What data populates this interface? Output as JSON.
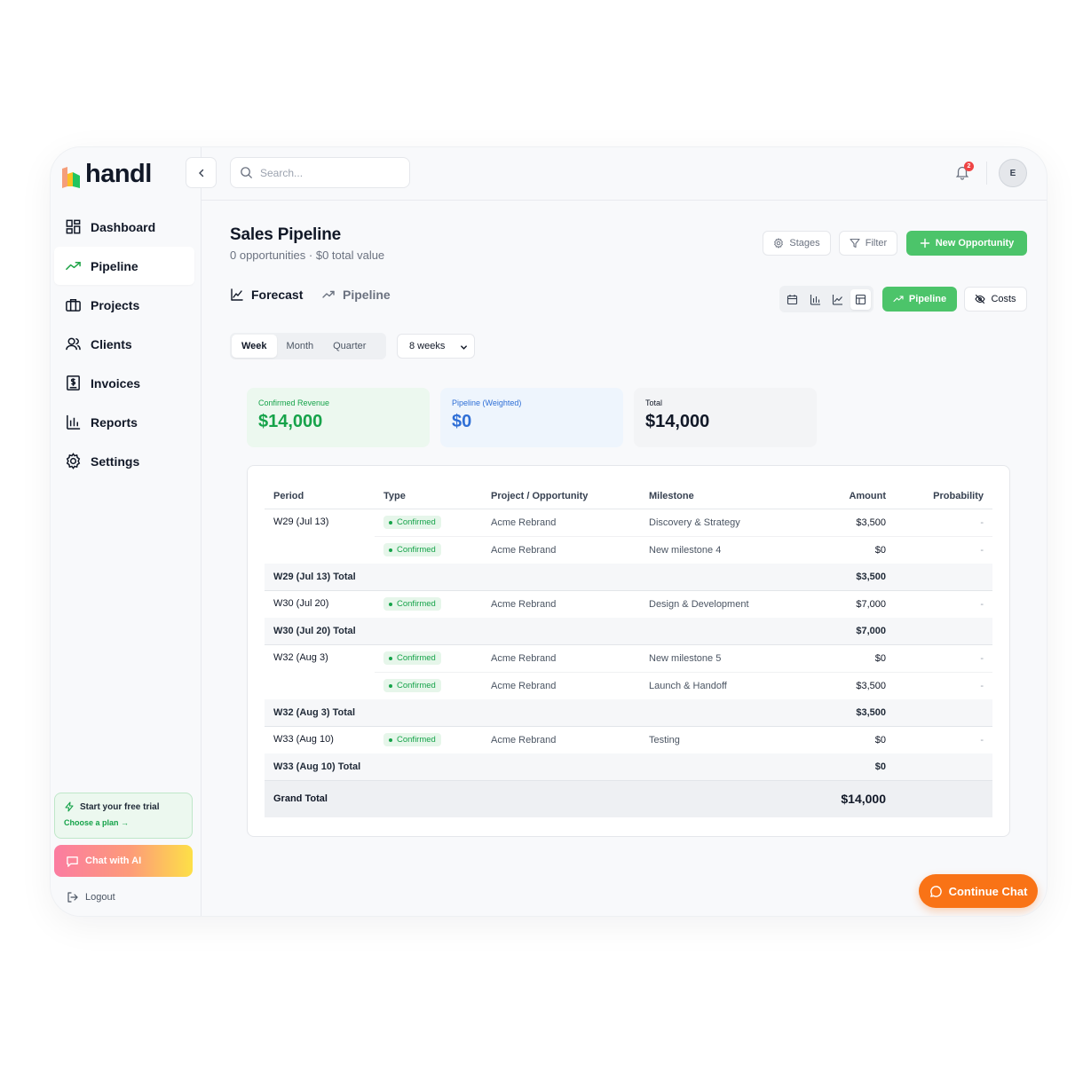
{
  "brand": {
    "name": "handl"
  },
  "sidebar": {
    "items": [
      {
        "label": "Dashboard",
        "icon": "dashboard-icon"
      },
      {
        "label": "Pipeline",
        "icon": "trending-up-icon",
        "active": true
      },
      {
        "label": "Projects",
        "icon": "briefcase-icon"
      },
      {
        "label": "Clients",
        "icon": "users-icon"
      },
      {
        "label": "Invoices",
        "icon": "receipt-icon"
      },
      {
        "label": "Reports",
        "icon": "bar-chart-icon"
      },
      {
        "label": "Settings",
        "icon": "gear-icon"
      }
    ],
    "trial_title": "Start your free trial",
    "trial_link": "Choose a plan →",
    "chat_ai": "Chat with AI",
    "logout": "Logout"
  },
  "topbar": {
    "search_placeholder": "Search...",
    "notification_count": "2",
    "avatar_initial": "E"
  },
  "header": {
    "title": "Sales Pipeline",
    "subtitle": "0 opportunities · $0 total value",
    "stages_label": "Stages",
    "filter_label": "Filter",
    "new_label": "New Opportunity"
  },
  "tabs": {
    "forecast": "Forecast",
    "pipeline": "Pipeline"
  },
  "toggles": {
    "pipeline": "Pipeline",
    "costs": "Costs"
  },
  "period": {
    "options": [
      "Week",
      "Month",
      "Quarter"
    ],
    "selected": "Week",
    "range": "8 weeks"
  },
  "cards": {
    "confirmed": {
      "label": "Confirmed Revenue",
      "value": "$14,000"
    },
    "pipeline": {
      "label": "Pipeline (Weighted)",
      "value": "$0"
    },
    "total": {
      "label": "Total",
      "value": "$14,000"
    }
  },
  "table": {
    "headers": [
      "Period",
      "Type",
      "Project / Opportunity",
      "Milestone",
      "Amount",
      "Probability"
    ],
    "groups": [
      {
        "period": "W29 (Jul 13)",
        "rows": [
          {
            "type": "Confirmed",
            "project": "Acme Rebrand",
            "milestone": "Discovery & Strategy",
            "amount": "$3,500",
            "probability": "-"
          },
          {
            "type": "Confirmed",
            "project": "Acme Rebrand",
            "milestone": "New milestone 4",
            "amount": "$0",
            "probability": "-"
          }
        ],
        "total_label": "W29 (Jul 13) Total",
        "total": "$3,500"
      },
      {
        "period": "W30 (Jul 20)",
        "rows": [
          {
            "type": "Confirmed",
            "project": "Acme Rebrand",
            "milestone": "Design & Development",
            "amount": "$7,000",
            "probability": "-"
          }
        ],
        "total_label": "W30 (Jul 20) Total",
        "total": "$7,000"
      },
      {
        "period": "W32 (Aug 3)",
        "rows": [
          {
            "type": "Confirmed",
            "project": "Acme Rebrand",
            "milestone": "New milestone 5",
            "amount": "$0",
            "probability": "-"
          },
          {
            "type": "Confirmed",
            "project": "Acme Rebrand",
            "milestone": "Launch & Handoff",
            "amount": "$3,500",
            "probability": "-"
          }
        ],
        "total_label": "W32 (Aug 3) Total",
        "total": "$3,500"
      },
      {
        "period": "W33 (Aug 10)",
        "rows": [
          {
            "type": "Confirmed",
            "project": "Acme Rebrand",
            "milestone": "Testing",
            "amount": "$0",
            "probability": "-"
          }
        ],
        "total_label": "W33 (Aug 10) Total",
        "total": "$0"
      }
    ],
    "grand_total_label": "Grand Total",
    "grand_total": "$14,000"
  },
  "continue_chat": "Continue Chat",
  "colors": {
    "accent_green": "#4cc46a",
    "confirmed_bg": "#ecf8ef",
    "pipeline_bg": "#eef5fd",
    "pipeline_blue": "#2f6fd6",
    "orange": "#f97316"
  }
}
